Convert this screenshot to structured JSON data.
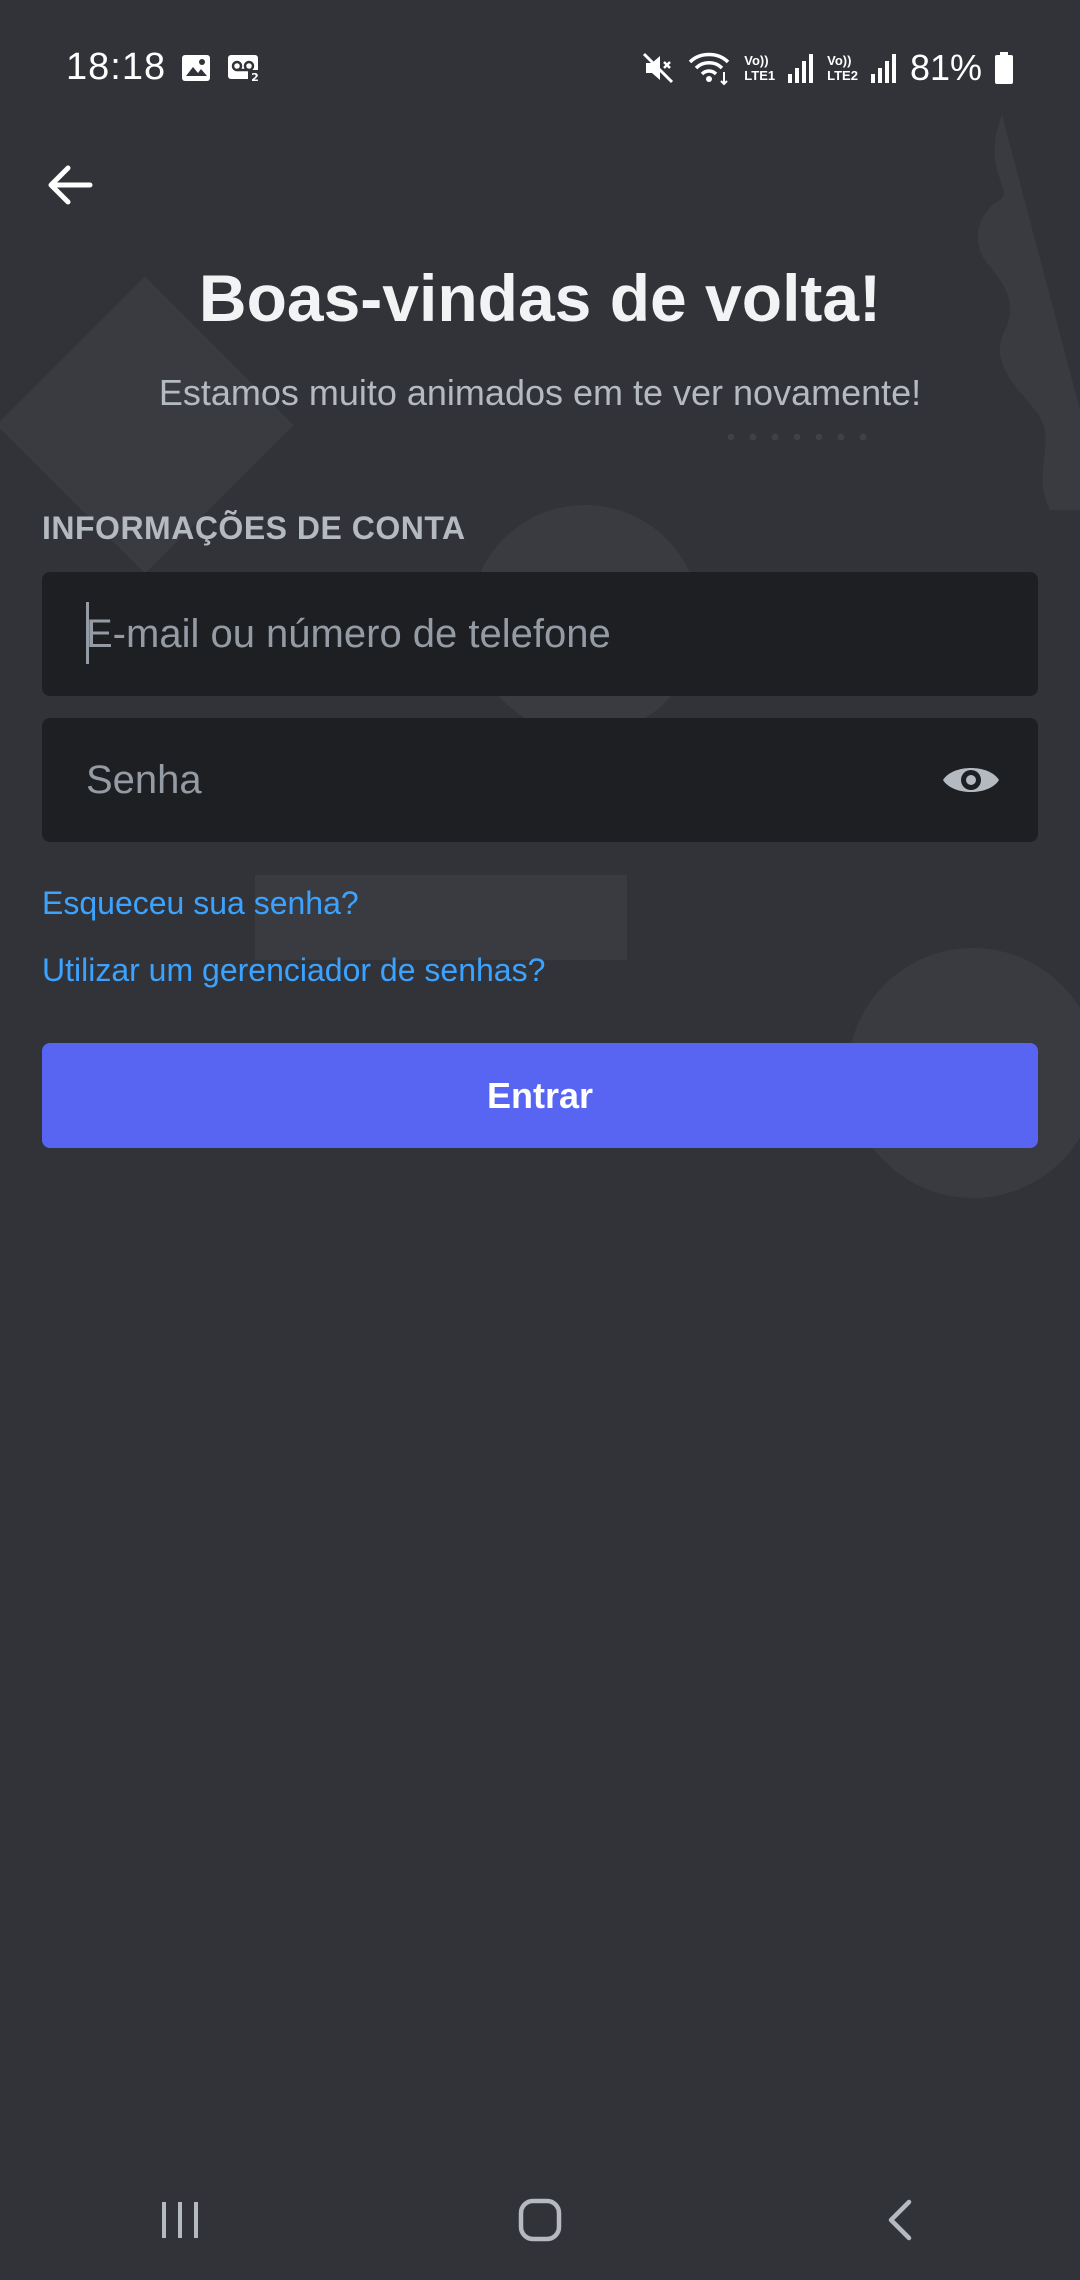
{
  "status_bar": {
    "time": "18:18",
    "battery": "81%",
    "sim1": {
      "top": "Vo))",
      "bottom": "LTE1"
    },
    "sim2": {
      "top": "Vo))",
      "bottom": "LTE2"
    }
  },
  "login": {
    "title": "Boas-vindas de volta!",
    "subtitle": "Estamos muito animados em te ver novamente!",
    "section_label": "INFORMAÇÕES DE CONTA",
    "email_placeholder": "E-mail ou número de telefone",
    "email_value": "",
    "password_placeholder": "Senha",
    "password_value": "",
    "forgot_password": "Esqueceu sua senha?",
    "password_manager": "Utilizar um gerenciador de senhas?",
    "submit_label": "Entrar"
  },
  "colors": {
    "background": "#313338",
    "input_bg": "#1e1f22",
    "accent": "#5865f2",
    "link": "#3ba3ff"
  },
  "icons": {
    "back": "arrow-left-icon",
    "show_password": "eye-icon",
    "nav_recents": "recents-icon",
    "nav_home": "home-icon",
    "nav_back": "back-chevron-icon"
  }
}
